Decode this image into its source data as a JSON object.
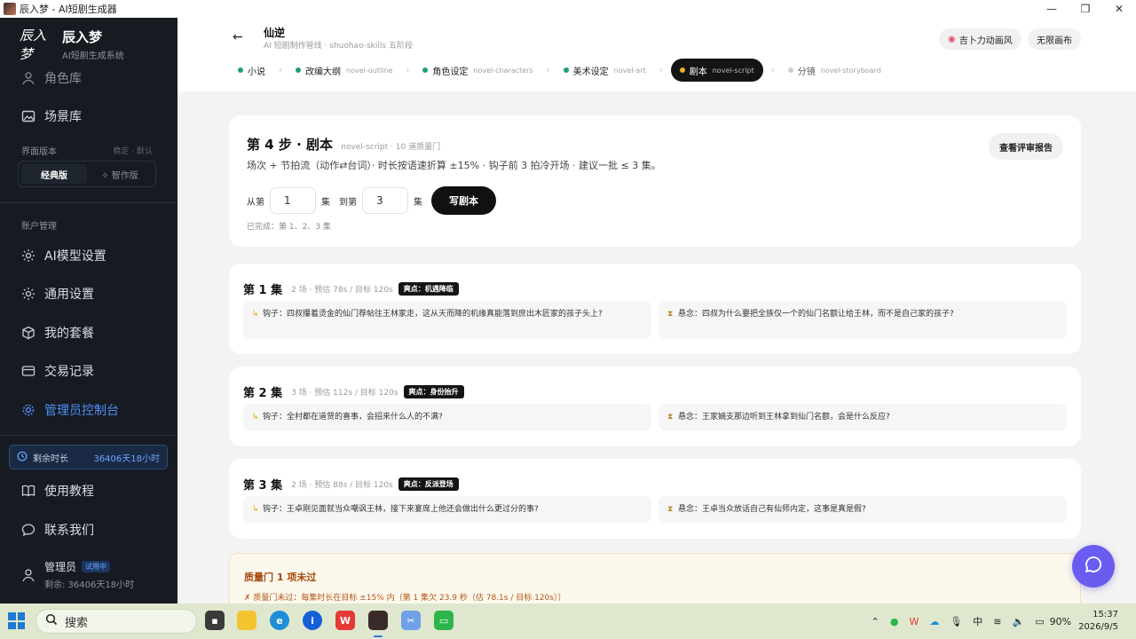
{
  "window": {
    "title": "辰入梦 - AI短剧生成器"
  },
  "sidebar": {
    "brand_name": "辰入梦",
    "brand_sub": "AI短剧生成系统",
    "brand_logo": "辰入梦",
    "items_top": [
      {
        "label": "角色库",
        "icon": "user-icon"
      },
      {
        "label": "场景库",
        "icon": "image-icon"
      }
    ],
    "version_label": "界面版本",
    "version_aux": "稳定 · 默认",
    "version_options": [
      "经典版",
      "✧ 智作版"
    ],
    "account_label": "账户管理",
    "items_account": [
      {
        "label": "AI模型设置",
        "icon": "gear-icon"
      },
      {
        "label": "通用设置",
        "icon": "gear-icon"
      },
      {
        "label": "我的套餐",
        "icon": "package-icon"
      },
      {
        "label": "交易记录",
        "icon": "card-icon"
      },
      {
        "label": "管理员控制台",
        "icon": "gear-icon",
        "active": true
      }
    ],
    "remain_label": "剩余时长",
    "remain_value": "36406天18小时",
    "items_bottom": [
      {
        "label": "使用教程",
        "icon": "book-icon"
      },
      {
        "label": "联系我们",
        "icon": "chat-icon"
      }
    ],
    "user": {
      "name": "管理员",
      "badge": "试用中",
      "sub": "剩余: 36406天18小时"
    }
  },
  "header": {
    "back": "←",
    "title": "仙逆",
    "subtitle": "AI 短剧制作管线 · shuohao-skills 五阶段",
    "pills": [
      "吉卜力动画风",
      "无限画布"
    ],
    "pill_icon": "palette-icon",
    "steps": [
      {
        "label": "小说",
        "code": "",
        "state": "done"
      },
      {
        "label": "改编大纲",
        "code": "novel-outline",
        "state": "done"
      },
      {
        "label": "角色设定",
        "code": "novel-characters",
        "state": "done"
      },
      {
        "label": "美术设定",
        "code": "novel-art",
        "state": "done"
      },
      {
        "label": "剧本",
        "code": "novel-script",
        "state": "active"
      },
      {
        "label": "分镜",
        "code": "novel-storyboard",
        "state": "pending"
      }
    ]
  },
  "step_card": {
    "title": "第 4 步 · 剧本",
    "meta": "novel-script · 10 道质量门",
    "desc": "场次 + 节拍流（动作⇄台词）· 时长按语速折算 ±15% · 钩子前 3 拍冷开场 · 建议一批 ≤ 3 集。",
    "review_btn": "查看评审报告",
    "from_label": "从第",
    "from_value": "1",
    "ep_unit": "集",
    "to_label": "到第",
    "to_value": "3",
    "write_btn": "写剧本",
    "done_text": "已完成：第 1、2、3 集"
  },
  "episodes": [
    {
      "title": "第 1 集",
      "meta": "2 场 · 预估 78s / 目标 120s",
      "badge": "爽点：机遇降临",
      "hook": "钩子：四叔攥着烫金的仙门荐帖往王林家走，这从天而降的机缘真能落到庶出木匠家的孩子头上?",
      "suspense": "悬念：四叔为什么要把全族仅一个的仙门名额让给王林，而不是自己家的孩子?"
    },
    {
      "title": "第 2 集",
      "meta": "3 场 · 预估 112s / 目标 120s",
      "badge": "爽点：身份抬升",
      "hook": "钩子：全村都在道贺的喜事，会招来什么人的不满?",
      "suspense": "悬念：王家嫡支那边听到王林拿到仙门名额，会是什么反应?"
    },
    {
      "title": "第 3 集",
      "meta": "2 场 · 预估 88s / 目标 120s",
      "badge": "爽点：反派登场",
      "hook": "钩子：王卓刚见面就当众嘲讽王林，接下来宴席上他还会做出什么更过分的事?",
      "suspense": "悬念：王卓当众放话自己有仙师内定，这事是真是假?"
    }
  ],
  "quality": {
    "title": "质量门 1 项未过",
    "line": "✗ 质量门未过：每集时长在目标 ±15% 内（第 1 集欠 23.9 秒（估 78.1s / 目标 120s））"
  },
  "taskbar": {
    "search_placeholder": "搜索",
    "ime": "中",
    "battery": "90%",
    "time": "15:37",
    "date": "2026/9/5"
  },
  "colors": {
    "accent": "#4f8ff7",
    "sidebar_bg": "#161b22",
    "done_dot": "#1aa36b",
    "active_dot": "#f2b01e",
    "fab": "#6a5cf0"
  }
}
